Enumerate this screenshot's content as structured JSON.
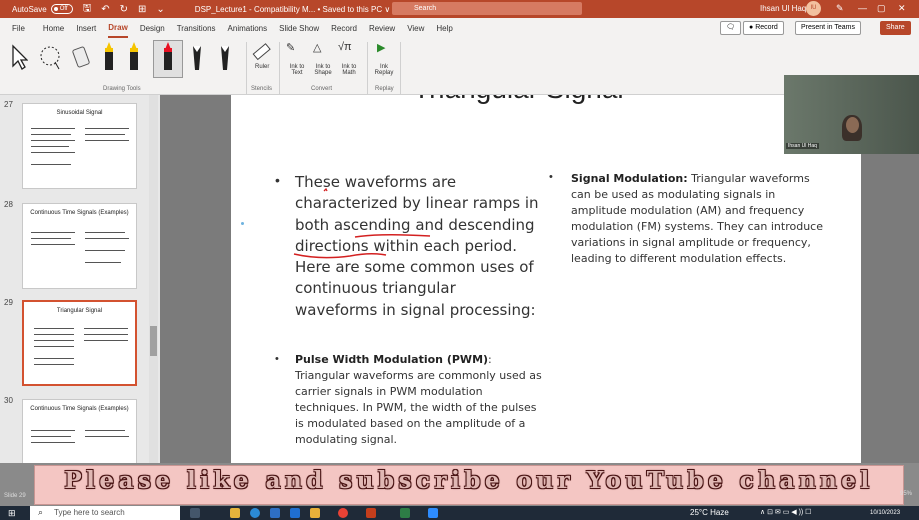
{
  "titlebar": {
    "autosave": "AutoSave",
    "toggle": "Off",
    "doc_title": "DSP_Lecture1 - Compatibility M... • Saved to this PC ∨",
    "search": "Search",
    "user": "Ihsan Ul Haq",
    "initials": "IU"
  },
  "menu": {
    "items": [
      "File",
      "Home",
      "Insert",
      "Draw",
      "Design",
      "Transitions",
      "Animations",
      "Slide Show",
      "Record",
      "Review",
      "View",
      "Help"
    ],
    "active": "Draw",
    "record_btn": "Record",
    "teams_btn": "Present in Teams",
    "share_btn": "Share"
  },
  "ribbon": {
    "groups": [
      "Drawing Tools",
      "Stencils",
      "Convert",
      "Replay"
    ],
    "ruler": "Ruler",
    "ink_to_text": "Ink to Text",
    "ink_to_shape": "Ink to Shape",
    "ink_to_math": "Ink to Math",
    "ink_replay": "Ink Replay"
  },
  "thumbs": [
    {
      "num": "27",
      "title": "Sinusoidal Signal"
    },
    {
      "num": "28",
      "title": "Continuous Time Signals (Examples)"
    },
    {
      "num": "29",
      "title": "Triangular Signal"
    },
    {
      "num": "30",
      "title": "Continuous Time Signals (Examples)"
    }
  ],
  "slide": {
    "title": "Triangular Signal",
    "para": "These waveforms are characterized by linear ramps in both ascending and descending directions within each period. Here are some common uses of continuous triangular waveforms in signal processing:",
    "pwm_heading": "Pulse Width Modulation (PWM)",
    "pwm_text": ": Triangular waveforms are commonly used as carrier signals in PWM modulation techniques. In PWM, the width of the pulses is modulated based on the amplitude of a modulating signal.",
    "sigmod_heading": "Signal Modulation:",
    "sigmod_text": " Triangular waveforms can be used as modulating signals in amplitude modulation (AM) and frequency modulation (FM) systems. They can introduce variations in signal amplitude or frequency, leading to different modulation effects."
  },
  "webcam": {
    "label": "Ihsan Ul Haq"
  },
  "banner": {
    "text": "Please like and subscribe our YouTube channel"
  },
  "status": {
    "slide": "Slide 29",
    "zoom": "95%"
  },
  "taskbar": {
    "search": "Type here to search",
    "weather": "25°C Haze",
    "time": "10/10/2023"
  }
}
